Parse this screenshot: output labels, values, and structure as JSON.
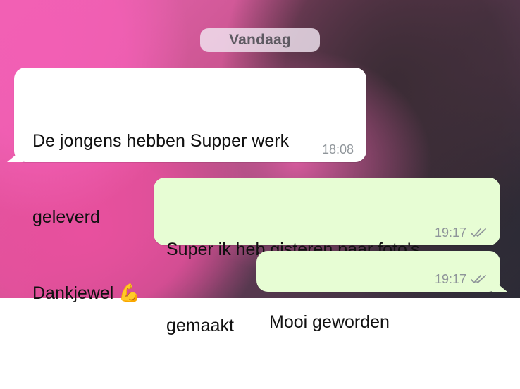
{
  "date_chip": {
    "label": "Vandaag"
  },
  "messages": [
    {
      "direction": "incoming",
      "lines": [
        "De jongens hebben Supper werk",
        "geleverd",
        "Dankjewel"
      ],
      "emoji": "💪",
      "emoji_icon": "flexed-biceps-icon",
      "time": "18:08"
    },
    {
      "direction": "outgoing",
      "lines": [
        "Super ik heb gisteren paar foto’s",
        "gemaakt"
      ],
      "time": "19:17",
      "status": "double-check-icon"
    },
    {
      "direction": "outgoing",
      "lines": [
        "Mooi geworden"
      ],
      "time": "19:17",
      "status": "double-check-icon"
    }
  ],
  "colors": {
    "incoming_bubble": "#ffffff",
    "outgoing_bubble": "#e7fdd4",
    "timestamp": "#8f959a",
    "date_chip_text": "#5e5a62"
  }
}
